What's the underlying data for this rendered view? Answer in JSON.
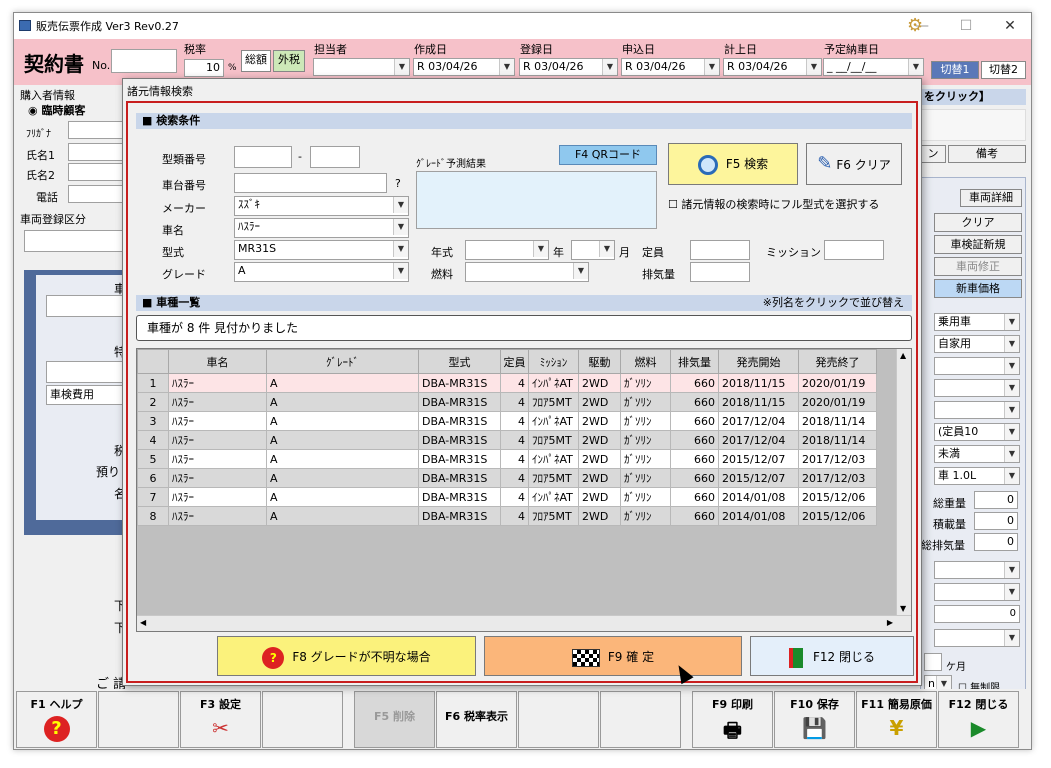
{
  "window": {
    "title": "販売伝票作成 Ver3 Rev0.27",
    "min": "—",
    "max": "☐",
    "close": "✕"
  },
  "header": {
    "doc_title": "契約書",
    "no_label": "No.",
    "no_value": "",
    "tax_label": "税率",
    "tax_value": "10",
    "tax_unit": "%",
    "tax_total": "総額",
    "tax_ex": "外税",
    "staff_label": "担当者",
    "staff_value": "",
    "created_label": "作成日",
    "created_value": "R 03/04/26",
    "registered_label": "登録日",
    "registered_value": "R 03/04/26",
    "applied_label": "申込日",
    "applied_value": "R 03/04/26",
    "booked_label": "計上日",
    "booked_value": "R 03/04/26",
    "delivery_label": "予定納車日",
    "delivery_value": "_ __/__/__",
    "switch1": "切替1",
    "switch2": "切替2"
  },
  "left_panel": {
    "buyer_info": "購入者情報",
    "temp_customer": "臨時顧客",
    "furigana": "ﾌﾘｶﾞﾅ",
    "name1": "氏名1",
    "name2": "氏名2",
    "phone": "電話",
    "reg_class": "車両登録区分",
    "inspection_cost": "車検費用",
    "frag_car": "車",
    "frag_special": "特",
    "frag_tax": "税",
    "frag_deposit": "預り",
    "frag_name": "名",
    "frag_lower1": "下",
    "frag_lower2": "下",
    "frag_bottom": "ご 請"
  },
  "right_panel": {
    "click_hint": "をクリック】",
    "remarks_partial": "ン",
    "remarks": "備考",
    "vehicle_detail": "車両詳細",
    "clear": "クリア",
    "inspection_new": "車検証新規",
    "vehicle_edit": "車両修正",
    "new_car_price": "新車価格",
    "combo1": "乗用車",
    "combo2": "自家用",
    "combo3": "",
    "combo4": "(定員10",
    "combo5": "未満",
    "combo6": "車 1.0L",
    "total_weight": "総重量",
    "total_weight_val": "0",
    "load": "積載量",
    "load_val": "0",
    "total_disp": "総排気量",
    "total_disp_val": "0",
    "zero_val": "0",
    "months": "ケ月",
    "unlimited": "無制限",
    "frag_n": "n"
  },
  "dialog": {
    "title": "諸元情報検索",
    "search_section": "■ 検索条件",
    "type_no_label": "型類番号",
    "type_no_a": "",
    "dash": "-",
    "type_no_b": "",
    "chassis_label": "車台番号",
    "chassis_value": "",
    "q": "?",
    "maker_label": "メーカー",
    "maker_value": "ｽｽﾞｷ",
    "car_label": "車名",
    "car_value": "ﾊｽﾗｰ",
    "model_label": "型式",
    "model_value": "MR31S",
    "grade_label": "グレード",
    "grade_value": "A",
    "grade_pred": "ｸﾞﾚｰﾄﾞ予測結果",
    "qr_button": "F4 QRコード",
    "search_button": "F5 検索",
    "clear_button": "F6 クリア",
    "fullmodel_check": "諸元情報の検索時にフル型式を選択する",
    "year_label": "年式",
    "year_unit": "年",
    "month_unit": "月",
    "capacity_label": "定員",
    "mission_label": "ミッション",
    "fuel_label": "燃料",
    "displacement_label": "排気量",
    "list_section": "■ 車種一覧",
    "sort_hint": "※列名をクリックで並び替え",
    "found_text": "車種が 8 件 見付かりました",
    "btn_unknown": "F8 グレードが不明な場合",
    "btn_confirm": "F9 確 定",
    "btn_close": "F12 閉じる"
  },
  "table": {
    "columns": [
      "",
      "車名",
      "ｸﾞﾚｰﾄﾞ",
      "型式",
      "定員",
      "ﾐｯｼｮﾝ",
      "駆動",
      "燃料",
      "排気量",
      "発売開始",
      "発売終了"
    ],
    "rows": [
      [
        "1",
        "ﾊｽﾗｰ",
        "A",
        "DBA-MR31S",
        "4",
        "ｲﾝﾊﾟﾈAT",
        "2WD",
        "ｶﾞｿﾘﾝ",
        "660",
        "2018/11/15",
        "2020/01/19"
      ],
      [
        "2",
        "ﾊｽﾗｰ",
        "A",
        "DBA-MR31S",
        "4",
        "ﾌﾛｱ5MT",
        "2WD",
        "ｶﾞｿﾘﾝ",
        "660",
        "2018/11/15",
        "2020/01/19"
      ],
      [
        "3",
        "ﾊｽﾗｰ",
        "A",
        "DBA-MR31S",
        "4",
        "ｲﾝﾊﾟﾈAT",
        "2WD",
        "ｶﾞｿﾘﾝ",
        "660",
        "2017/12/04",
        "2018/11/14"
      ],
      [
        "4",
        "ﾊｽﾗｰ",
        "A",
        "DBA-MR31S",
        "4",
        "ﾌﾛｱ5MT",
        "2WD",
        "ｶﾞｿﾘﾝ",
        "660",
        "2017/12/04",
        "2018/11/14"
      ],
      [
        "5",
        "ﾊｽﾗｰ",
        "A",
        "DBA-MR31S",
        "4",
        "ｲﾝﾊﾟﾈAT",
        "2WD",
        "ｶﾞｿﾘﾝ",
        "660",
        "2015/12/07",
        "2017/12/03"
      ],
      [
        "6",
        "ﾊｽﾗｰ",
        "A",
        "DBA-MR31S",
        "4",
        "ﾌﾛｱ5MT",
        "2WD",
        "ｶﾞｿﾘﾝ",
        "660",
        "2015/12/07",
        "2017/12/03"
      ],
      [
        "7",
        "ﾊｽﾗｰ",
        "A",
        "DBA-MR31S",
        "4",
        "ｲﾝﾊﾟﾈAT",
        "2WD",
        "ｶﾞｿﾘﾝ",
        "660",
        "2014/01/08",
        "2015/12/06"
      ],
      [
        "8",
        "ﾊｽﾗｰ",
        "A",
        "DBA-MR31S",
        "4",
        "ﾌﾛｱ5MT",
        "2WD",
        "ｶﾞｿﾘﾝ",
        "660",
        "2014/01/08",
        "2015/12/06"
      ]
    ]
  },
  "fkeys": [
    {
      "label": "F1 ヘルプ",
      "icon": "?"
    },
    {
      "label": "",
      "icon": ""
    },
    {
      "label": "F3 設定",
      "icon": "✂"
    },
    {
      "label": "",
      "icon": ""
    },
    {
      "label": "F5 削除",
      "icon": ""
    },
    {
      "label": "F6 税率表示",
      "icon": ""
    },
    {
      "label": "",
      "icon": ""
    },
    {
      "label": "",
      "icon": ""
    },
    {
      "label": "F9 印刷",
      "icon": "🖶"
    },
    {
      "label": "F10 保存",
      "icon": "💾"
    },
    {
      "label": "F11 簡易原価",
      "icon": "¥"
    },
    {
      "label": "F12 閉じる",
      "icon": "▶"
    }
  ],
  "colors": {
    "header_pink": "#f6c1c9",
    "dialog_border": "#c81e1e",
    "selected_row": "#fde4e6",
    "section_blue": "#c9d6ea",
    "confirm_orange": "#fbb67a",
    "unknown_yellow": "#fbf27c",
    "search_yellow": "#fdf59c",
    "close_blue": "#e4effa"
  }
}
